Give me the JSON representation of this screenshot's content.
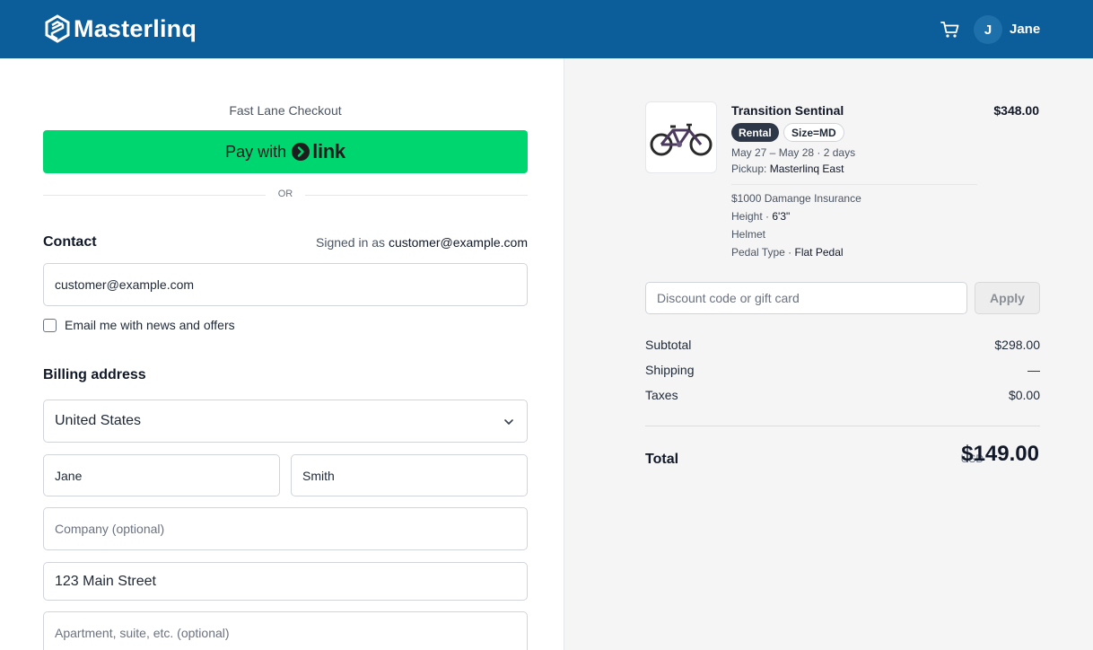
{
  "header": {
    "brand": "Masterlinq",
    "user_initial": "J",
    "user_name": "Jane",
    "brand_color": "#0b5e99"
  },
  "checkout": {
    "fast_lane_label": "Fast Lane Checkout",
    "pay_with_label": "Pay with",
    "link_label": "link",
    "or_label": "OR",
    "link_color": "#00d66f"
  },
  "contact": {
    "title": "Contact",
    "signed_in_prefix": "Signed in as",
    "signed_in_email": "customer@example.com",
    "email_value": "customer@example.com",
    "newsletter_label": "Email me with news and offers",
    "newsletter_checked": false
  },
  "billing": {
    "title": "Billing address",
    "country": "United States",
    "first_name": "Jane",
    "last_name": "Smith",
    "company_placeholder": "Company (optional)",
    "address": "123 Main Street",
    "apartment_placeholder": "Apartment, suite, etc. (optional)"
  },
  "order": {
    "product": {
      "title": "Transition Sentinal",
      "price": "$348.00",
      "badge_type": "Rental",
      "badge_size": "Size=MD",
      "dates": "May 27 – May 28 · 2 days",
      "pickup_label": "Pickup:",
      "pickup_location": "Masterlinq East",
      "addons": [
        {
          "label": "$1000 Damange Insurance",
          "value": ""
        },
        {
          "label": "Height ·",
          "value": "6'3\""
        },
        {
          "label": "Helmet",
          "value": ""
        },
        {
          "label": "Pedal Type ·",
          "value": "Flat Pedal"
        }
      ]
    },
    "discount_placeholder": "Discount code or gift card",
    "apply_label": "Apply",
    "subtotal_label": "Subtotal",
    "subtotal_value": "$298.00",
    "shipping_label": "Shipping",
    "shipping_value": "—",
    "taxes_label": "Taxes",
    "taxes_value": "$0.00",
    "total_label": "Total",
    "total_currency": "USD",
    "total_value": "$149.00"
  }
}
